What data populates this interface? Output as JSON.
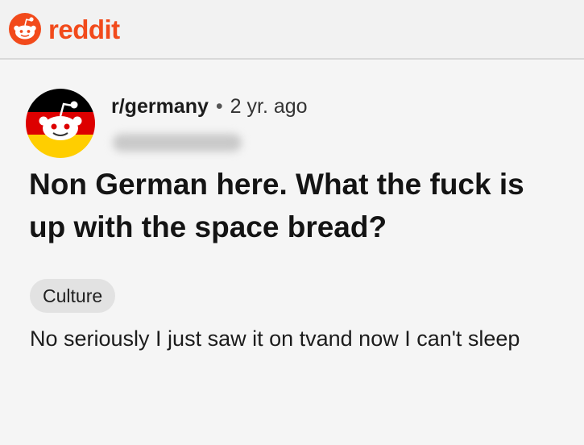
{
  "header": {
    "brand": "reddit",
    "logo_icon": "reddit-snoo-icon",
    "brand_color": "#f24a1b"
  },
  "post": {
    "subreddit": "r/germany",
    "separator": "•",
    "age": "2 yr. ago",
    "avatar_icon": "subreddit-avatar-icon",
    "title": "Non German here. What the fuck is up with the space bread?",
    "flair": "Culture",
    "body": "No seriously I just saw it on tvand now I can't sleep"
  }
}
